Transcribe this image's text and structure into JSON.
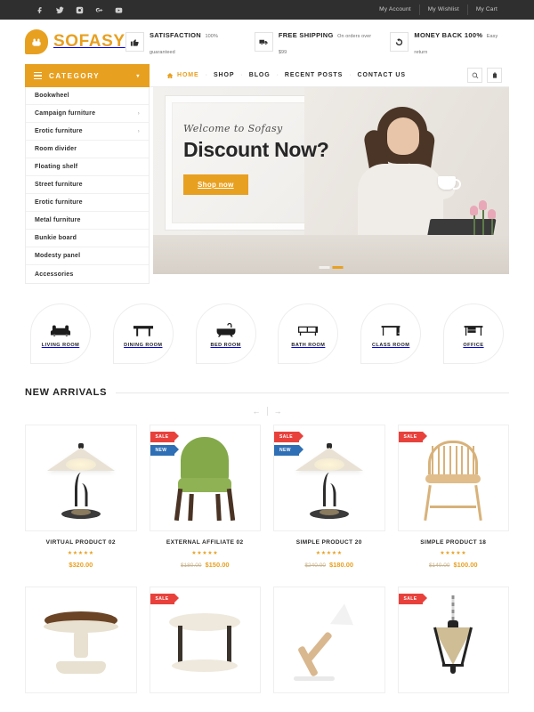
{
  "topbar": {
    "social": [
      {
        "name": "facebook-icon",
        "glyph": "f"
      },
      {
        "name": "twitter-icon",
        "glyph": "t"
      },
      {
        "name": "instagram-icon",
        "glyph": "i"
      },
      {
        "name": "google-plus-icon",
        "glyph": "g+"
      },
      {
        "name": "youtube-icon",
        "glyph": "y"
      }
    ],
    "links": [
      "My Account",
      "My Wishlist",
      "My Cart"
    ]
  },
  "header": {
    "logo_text": "SOFASY",
    "logo_icon": "armchair-icon",
    "features": [
      {
        "icon": "thumbs-up-icon",
        "title": "SATISFACTION",
        "sub": "100% guaranteed"
      },
      {
        "icon": "truck-icon",
        "title": "FREE SHIPPING",
        "sub": "On orders over $99"
      },
      {
        "icon": "refresh-icon",
        "title": "MONEY BACK 100%",
        "sub": "Easy return"
      }
    ]
  },
  "nav": {
    "category_label": "CATEGORY",
    "items": [
      {
        "label": "HOME",
        "active": true
      },
      {
        "label": "SHOP",
        "active": false
      },
      {
        "label": "BLOG",
        "active": false
      },
      {
        "label": "RECENT POSTS",
        "active": false
      },
      {
        "label": "CONTACT US",
        "active": false
      }
    ],
    "tools": [
      {
        "name": "search-icon"
      },
      {
        "name": "cart-icon"
      }
    ]
  },
  "sidebar": {
    "items": [
      {
        "label": "Bookwheel",
        "has_sub": false
      },
      {
        "label": "Campaign furniture",
        "has_sub": true
      },
      {
        "label": "Erotic furniture",
        "has_sub": true
      },
      {
        "label": "Room divider",
        "has_sub": false
      },
      {
        "label": "Floating shelf",
        "has_sub": false
      },
      {
        "label": "Street furniture",
        "has_sub": false
      },
      {
        "label": "Erotic furniture",
        "has_sub": false
      },
      {
        "label": "Metal furniture",
        "has_sub": false
      },
      {
        "label": "Bunkie board",
        "has_sub": false
      },
      {
        "label": "Modesty panel",
        "has_sub": false
      },
      {
        "label": "Accessories",
        "has_sub": false
      }
    ],
    "submenu_arrow": "›"
  },
  "hero": {
    "welcome": "Welcome to Sofasy",
    "title": "Discount Now?",
    "button": "Shop now",
    "slides": 2,
    "active_slide": 1
  },
  "rooms": [
    {
      "label": "LIVING ROOM",
      "icon": "sofa-icon"
    },
    {
      "label": "DINING ROOM",
      "icon": "dining-table-icon"
    },
    {
      "label": "BED ROOM",
      "icon": "bathtub-icon"
    },
    {
      "label": "BATH ROOM",
      "icon": "tv-stand-icon"
    },
    {
      "label": "CLASS ROOM",
      "icon": "desk-icon"
    },
    {
      "label": "OFFICE",
      "icon": "office-desk-icon"
    }
  ],
  "section": {
    "title": "NEW ARRIVALS",
    "prev": "←",
    "next": "→"
  },
  "products": [
    {
      "name": "VIRTUAL PRODUCT 02",
      "stars": "★★★★★",
      "old_price": "",
      "price": "$320.00",
      "badges": [],
      "art": "lamp"
    },
    {
      "name": "EXTERNAL AFFILIATE 02",
      "stars": "★★★★★",
      "old_price": "$180.00",
      "price": "$150.00",
      "badges": [
        "SALE",
        "NEW"
      ],
      "art": "green-chair"
    },
    {
      "name": "SIMPLE PRODUCT 20",
      "stars": "★★★★★",
      "old_price": "$240.00",
      "price": "$180.00",
      "badges": [
        "SALE",
        "NEW"
      ],
      "art": "lamp"
    },
    {
      "name": "SIMPLE PRODUCT 18",
      "stars": "★★★★★",
      "old_price": "$140.00",
      "price": "$100.00",
      "badges": [
        "SALE"
      ],
      "art": "wood-chair"
    }
  ],
  "products_row2": [
    {
      "badges": [],
      "art": "round-table"
    },
    {
      "badges": [
        "SALE"
      ],
      "art": "white-table"
    },
    {
      "badges": [],
      "art": "desk-lamp"
    },
    {
      "badges": [
        "SALE"
      ],
      "art": "lantern"
    }
  ],
  "colors": {
    "accent": "#e8a020",
    "dark": "#2f2f2f",
    "sale": "#e8413c",
    "new": "#2f6fb5"
  }
}
